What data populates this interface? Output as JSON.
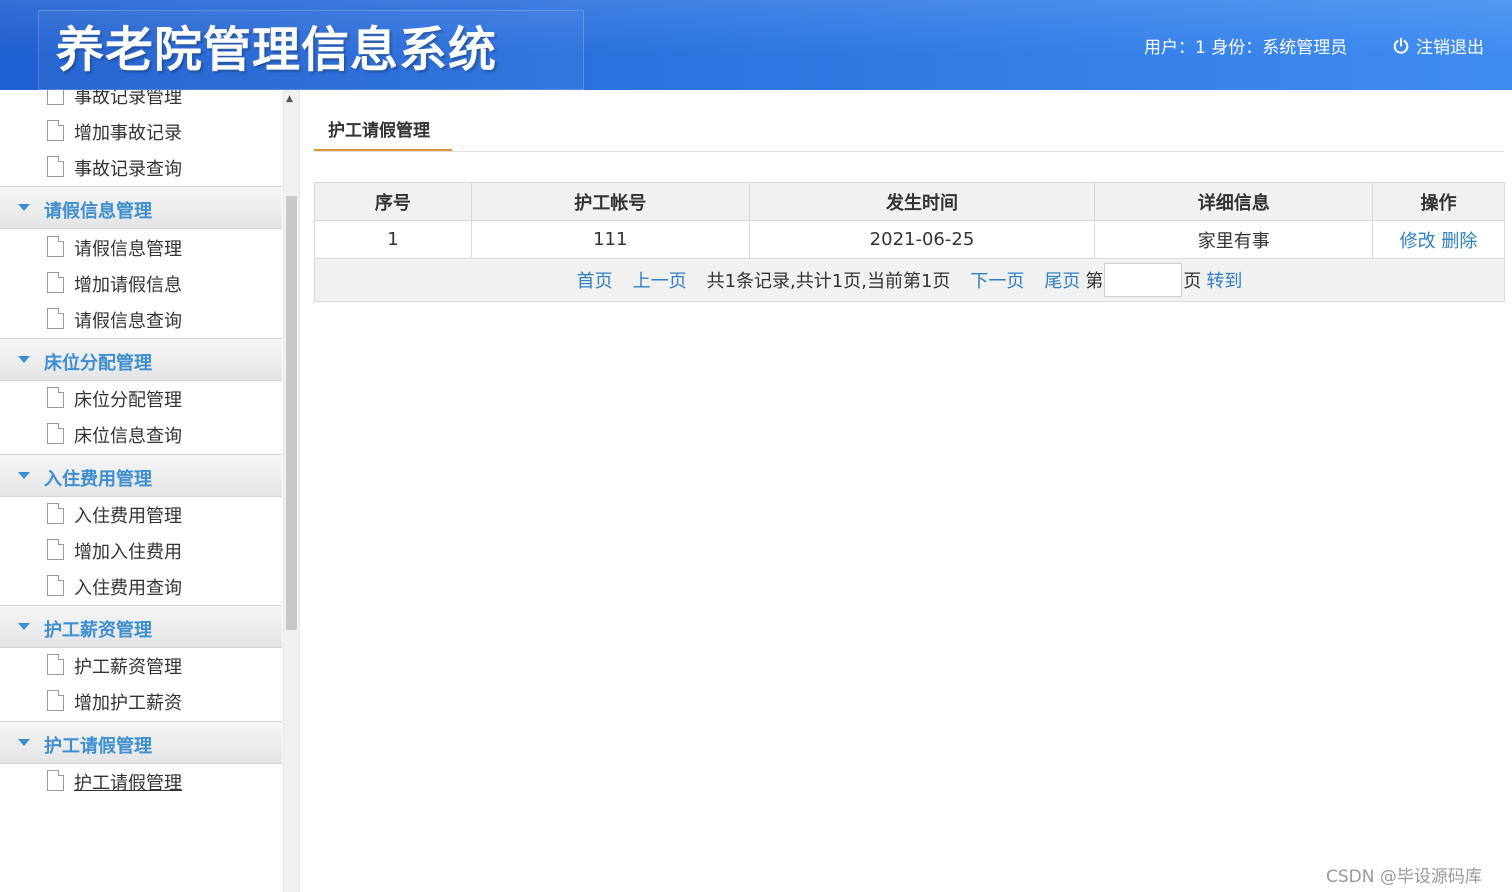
{
  "header": {
    "title": "养老院管理信息系统",
    "user_info": "用户：1 身份：系统管理员",
    "logout_label": "注销退出"
  },
  "sidebar": {
    "partial_top_item": "事故记录管理",
    "pre_items": [
      "增加事故记录",
      "事故记录查询"
    ],
    "groups": [
      {
        "label": "请假信息管理",
        "items": [
          "请假信息管理",
          "增加请假信息",
          "请假信息查询"
        ]
      },
      {
        "label": "床位分配管理",
        "items": [
          "床位分配管理",
          "床位信息查询"
        ]
      },
      {
        "label": "入住费用管理",
        "items": [
          "入住费用管理",
          "增加入住费用",
          "入住费用查询"
        ]
      },
      {
        "label": "护工薪资管理",
        "items": [
          "护工薪资管理",
          "增加护工薪资"
        ]
      },
      {
        "label": "护工请假管理",
        "items": [
          "护工请假管理"
        ]
      }
    ],
    "active_item": "护工请假管理"
  },
  "main": {
    "tab_title": "护工请假管理",
    "table": {
      "columns": [
        "序号",
        "护工帐号",
        "发生时间",
        "详细信息",
        "操作"
      ],
      "rows": [
        {
          "index": "1",
          "account": "111",
          "time": "2021-06-25",
          "detail": "家里有事",
          "edit": "修改",
          "delete": "删除"
        }
      ]
    },
    "pager": {
      "first": "首页",
      "prev": "上一页",
      "summary": "共1条记录,共计1页,当前第1页",
      "next": "下一页",
      "last": "尾页",
      "page_prefix": "第",
      "page_suffix": "页",
      "page_value": "",
      "goto": "转到"
    }
  },
  "watermark": "CSDN @毕设源码库",
  "colors": {
    "header_blue": "#2c74e0",
    "link_blue": "#2f7fc2",
    "group_label_blue": "#3d8fcf",
    "tab_accent": "#e0953a"
  }
}
